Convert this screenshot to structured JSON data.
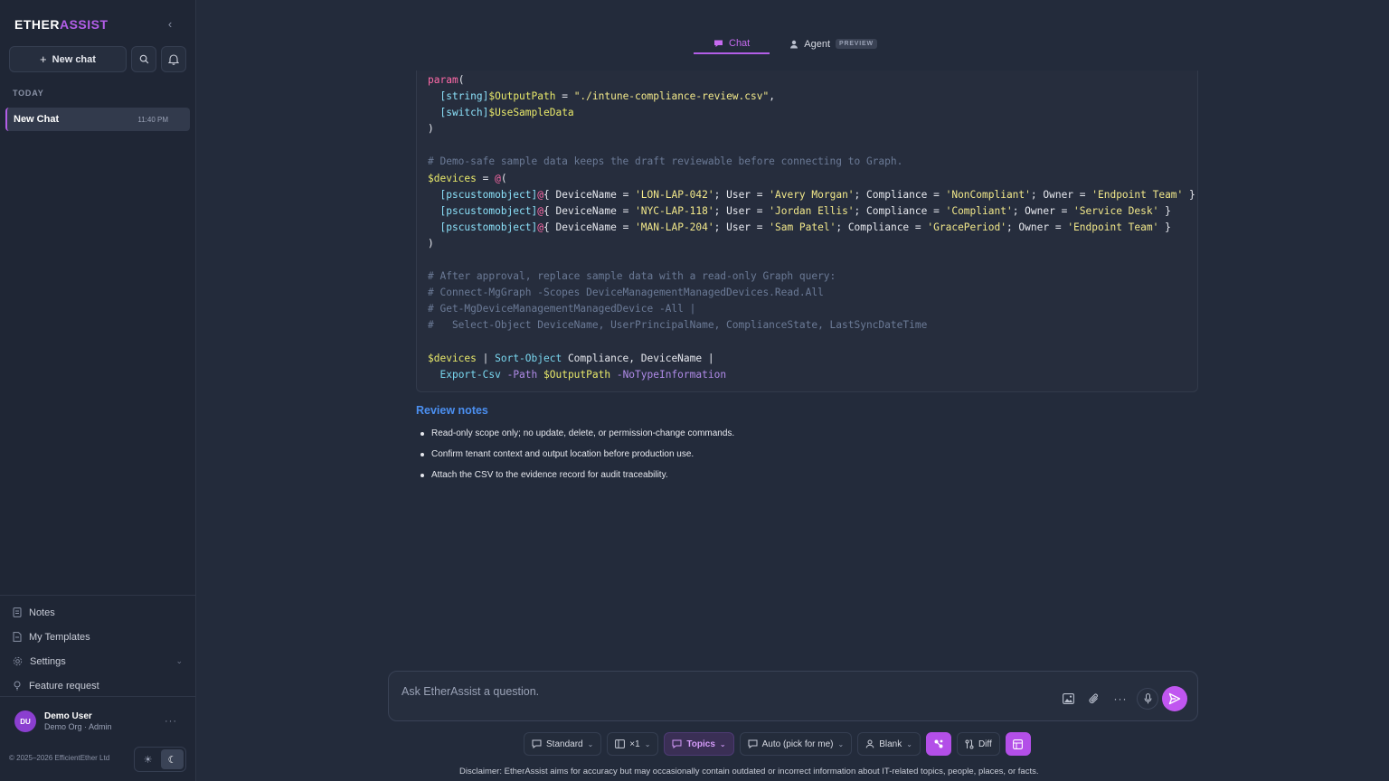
{
  "brand": {
    "part1": "ETHER",
    "part2": "ASSIST"
  },
  "sidebar": {
    "new_chat_label": "New chat",
    "section_today": "TODAY",
    "chats": [
      {
        "title": "New Chat",
        "time": "11:40 PM"
      }
    ],
    "nav": [
      {
        "label": "Notes",
        "icon": "notes-icon"
      },
      {
        "label": "My Templates",
        "icon": "template-icon"
      },
      {
        "label": "Settings",
        "icon": "gear-icon"
      },
      {
        "label": "Feature request",
        "icon": "lightbulb-icon"
      }
    ],
    "user": {
      "initials": "DU",
      "name": "Demo User",
      "sub": "Demo Org · Admin"
    },
    "copyright": "© 2025–2026 EfficientEther Ltd"
  },
  "tabs": {
    "chat": "Chat",
    "agent": "Agent",
    "preview_badge": "PREVIEW"
  },
  "code": {
    "lines": [
      [
        [
          "kw",
          "param"
        ],
        [
          "",
          "("
        ]
      ],
      [
        [
          "",
          "  "
        ],
        [
          "typ",
          "[string]"
        ],
        [
          "var",
          "$OutputPath"
        ],
        [
          "",
          " = "
        ],
        [
          "str",
          "\"./intune-compliance-review.csv\""
        ],
        [
          "",
          ","
        ]
      ],
      [
        [
          "",
          "  "
        ],
        [
          "typ",
          "[switch]"
        ],
        [
          "var",
          "$UseSampleData"
        ]
      ],
      [
        [
          "",
          ")"
        ]
      ],
      [
        [
          "",
          ""
        ]
      ],
      [
        [
          "cmt",
          "# Demo-safe sample data keeps the draft reviewable before connecting to Graph."
        ]
      ],
      [
        [
          "var",
          "$devices"
        ],
        [
          "",
          " = "
        ],
        [
          "kw",
          "@"
        ],
        [
          "",
          "("
        ]
      ],
      [
        [
          "",
          "  "
        ],
        [
          "typ",
          "[pscustomobject]"
        ],
        [
          "kw",
          "@"
        ],
        [
          "",
          "{ DeviceName = "
        ],
        [
          "str",
          "'LON-LAP-042'"
        ],
        [
          "",
          "; User = "
        ],
        [
          "str",
          "'Avery Morgan'"
        ],
        [
          "",
          "; Compliance = "
        ],
        [
          "str",
          "'NonCompliant'"
        ],
        [
          "",
          "; Owner = "
        ],
        [
          "str",
          "'Endpoint Team'"
        ],
        [
          "",
          " }"
        ]
      ],
      [
        [
          "",
          "  "
        ],
        [
          "typ",
          "[pscustomobject]"
        ],
        [
          "kw",
          "@"
        ],
        [
          "",
          "{ DeviceName = "
        ],
        [
          "str",
          "'NYC-LAP-118'"
        ],
        [
          "",
          "; User = "
        ],
        [
          "str",
          "'Jordan Ellis'"
        ],
        [
          "",
          "; Compliance = "
        ],
        [
          "str",
          "'Compliant'"
        ],
        [
          "",
          "; Owner = "
        ],
        [
          "str",
          "'Service Desk'"
        ],
        [
          "",
          " }"
        ]
      ],
      [
        [
          "",
          "  "
        ],
        [
          "typ",
          "[pscustomobject]"
        ],
        [
          "kw",
          "@"
        ],
        [
          "",
          "{ DeviceName = "
        ],
        [
          "str",
          "'MAN-LAP-204'"
        ],
        [
          "",
          "; User = "
        ],
        [
          "str",
          "'Sam Patel'"
        ],
        [
          "",
          "; Compliance = "
        ],
        [
          "str",
          "'GracePeriod'"
        ],
        [
          "",
          "; Owner = "
        ],
        [
          "str",
          "'Endpoint Team'"
        ],
        [
          "",
          " }"
        ]
      ],
      [
        [
          "",
          ")"
        ]
      ],
      [
        [
          "",
          ""
        ]
      ],
      [
        [
          "cmt",
          "# After approval, replace sample data with a read-only Graph query:"
        ]
      ],
      [
        [
          "cmt",
          "# Connect-MgGraph -Scopes DeviceManagementManagedDevices.Read.All"
        ]
      ],
      [
        [
          "cmt",
          "# Get-MgDeviceManagementManagedDevice -All |"
        ]
      ],
      [
        [
          "cmt",
          "#   Select-Object DeviceName, UserPrincipalName, ComplianceState, LastSyncDateTime"
        ]
      ],
      [
        [
          "",
          ""
        ]
      ],
      [
        [
          "var",
          "$devices"
        ],
        [
          "",
          " | "
        ],
        [
          "cmd",
          "Sort-Object"
        ],
        [
          "",
          " Compliance, DeviceName |"
        ]
      ],
      [
        [
          "",
          "  "
        ],
        [
          "cmd",
          "Export-Csv"
        ],
        [
          "prm",
          " -Path "
        ],
        [
          "var",
          "$OutputPath"
        ],
        [
          "prm",
          " -NoTypeInformation"
        ]
      ]
    ]
  },
  "review": {
    "title": "Review notes",
    "items": [
      "Read-only scope only; no update, delete, or permission-change commands.",
      "Confirm tenant context and output location before production use.",
      "Attach the CSV to the evidence record for audit traceability."
    ]
  },
  "composer": {
    "placeholder": "Ask EtherAssist a question."
  },
  "toolbar": {
    "standard": "Standard",
    "multiplier": "×1",
    "topics": "Topics",
    "auto": "Auto (pick for me)",
    "blank": "Blank",
    "diff": "Diff"
  },
  "disclaimer": "Disclaimer: EtherAssist aims for accuracy but may occasionally contain outdated or incorrect information about IT-related topics, people, places, or facts.",
  "colors": {
    "accent": "#b35ee8",
    "link": "#4b8ff0",
    "background": "#232b3b",
    "sidebar": "#1f2635"
  }
}
